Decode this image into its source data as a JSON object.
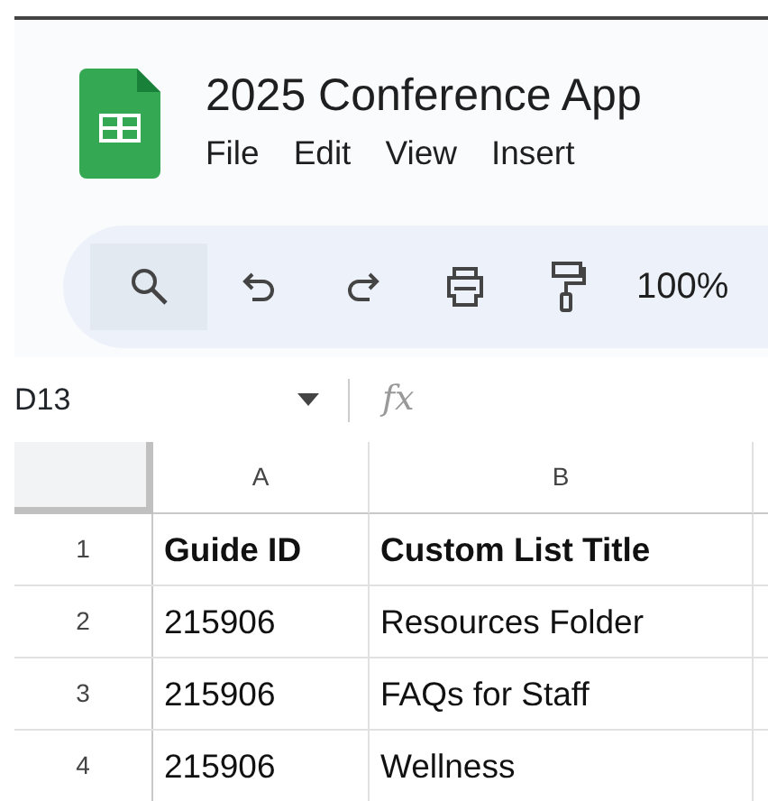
{
  "document": {
    "title": "2025 Conference App"
  },
  "menu": [
    "File",
    "Edit",
    "View",
    "Insert"
  ],
  "toolbar": {
    "zoom": "100%"
  },
  "formula_bar": {
    "cell_ref": "D13",
    "fx": "fx"
  },
  "table": {
    "columns": [
      "A",
      "B"
    ],
    "rows": [
      {
        "number": "1",
        "cells": [
          "Guide ID",
          "Custom List Title"
        ],
        "bold": true
      },
      {
        "number": "2",
        "cells": [
          "215906",
          "Resources Folder"
        ],
        "bold": false
      },
      {
        "number": "3",
        "cells": [
          "215906",
          "FAQs for Staff"
        ],
        "bold": false
      },
      {
        "number": "4",
        "cells": [
          "215906",
          "Wellness"
        ],
        "bold": false
      }
    ]
  }
}
